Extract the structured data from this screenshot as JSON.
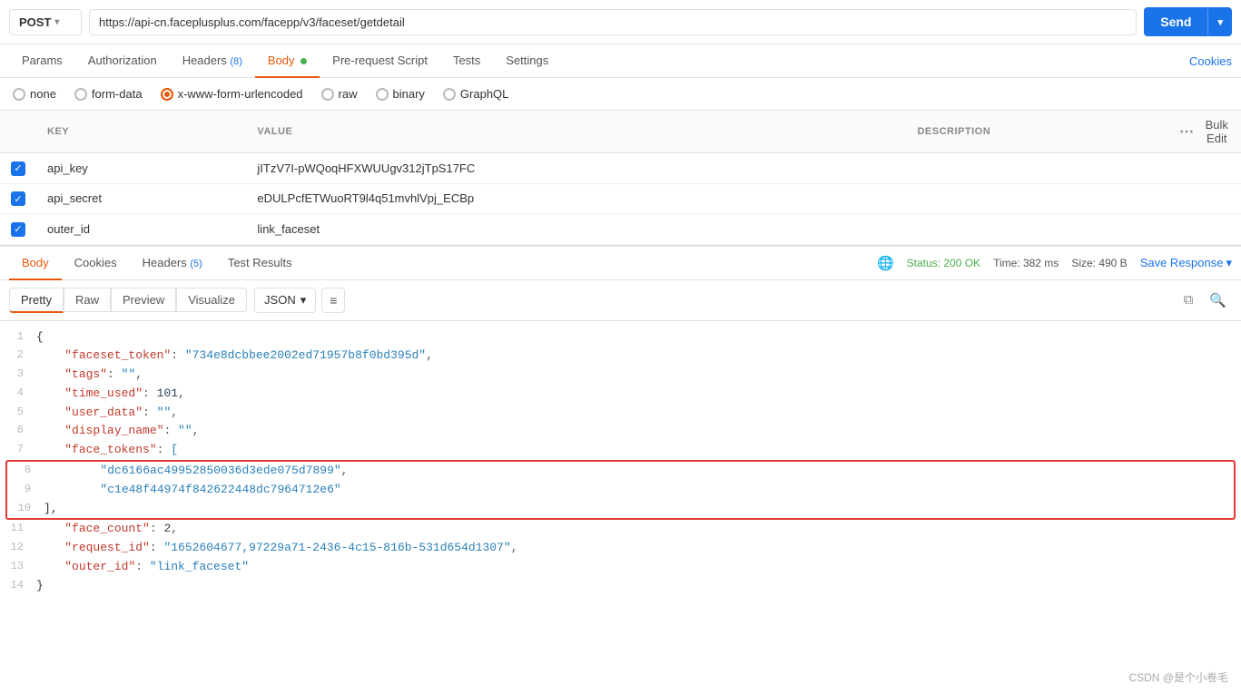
{
  "url_bar": {
    "method": "POST",
    "url": "https://api-cn.faceplusplus.com/facepp/v3/faceset/getdetail",
    "send_label": "Send"
  },
  "req_tabs": [
    {
      "label": "Params",
      "active": false,
      "badge": ""
    },
    {
      "label": "Authorization",
      "active": false,
      "badge": ""
    },
    {
      "label": "Headers",
      "active": false,
      "badge": "(8)"
    },
    {
      "label": "Body",
      "active": true,
      "badge": "",
      "dot": true
    },
    {
      "label": "Pre-request Script",
      "active": false,
      "badge": ""
    },
    {
      "label": "Tests",
      "active": false,
      "badge": ""
    },
    {
      "label": "Settings",
      "active": false,
      "badge": ""
    }
  ],
  "cookies_label": "Cookies",
  "body_types": [
    {
      "label": "none",
      "active": false
    },
    {
      "label": "form-data",
      "active": false
    },
    {
      "label": "x-www-form-urlencoded",
      "active": true
    },
    {
      "label": "raw",
      "active": false
    },
    {
      "label": "binary",
      "active": false
    },
    {
      "label": "GraphQL",
      "active": false
    }
  ],
  "table": {
    "headers": [
      "",
      "KEY",
      "VALUE",
      "DESCRIPTION",
      "",
      "Bulk Edit"
    ],
    "rows": [
      {
        "checked": true,
        "key": "api_key",
        "value": "jITzV7I-pWQoqHFXWUUgv312jTpS17FC",
        "desc": ""
      },
      {
        "checked": true,
        "key": "api_secret",
        "value": "eDULPcfETWuoRT9l4q51mvhlVpj_ECBp",
        "desc": ""
      },
      {
        "checked": true,
        "key": "outer_id",
        "value": "link_faceset",
        "desc": ""
      }
    ]
  },
  "resp_tabs": [
    {
      "label": "Body",
      "active": true,
      "badge": ""
    },
    {
      "label": "Cookies",
      "active": false,
      "badge": ""
    },
    {
      "label": "Headers",
      "active": false,
      "badge": "(5)"
    },
    {
      "label": "Test Results",
      "active": false,
      "badge": ""
    }
  ],
  "resp_status": {
    "status": "Status: 200 OK",
    "time": "Time: 382 ms",
    "size": "Size: 490 B"
  },
  "save_response_label": "Save Response",
  "resp_toolbar": {
    "views": [
      "Pretty",
      "Raw",
      "Preview",
      "Visualize"
    ],
    "active_view": "Pretty",
    "format": "JSON",
    "wrap_icon": "≡"
  },
  "json_lines": [
    {
      "num": 1,
      "content": "{"
    },
    {
      "num": 2,
      "key": "faceset_token",
      "value": "\"734e8dcbbee2002ed71957b8f0bd395d\"",
      "colon": ": ",
      "comma": ","
    },
    {
      "num": 3,
      "key": "tags",
      "value": "\"\"",
      "colon": ": ",
      "comma": ","
    },
    {
      "num": 4,
      "key": "time_used",
      "value": "101",
      "colon": ": ",
      "comma": ",",
      "num_val": true
    },
    {
      "num": 5,
      "key": "user_data",
      "value": "\"\"",
      "colon": ": ",
      "comma": ","
    },
    {
      "num": 6,
      "key": "display_name",
      "value": "\"\"",
      "colon": ": ",
      "comma": ","
    },
    {
      "num": 7,
      "key": "face_tokens",
      "value": "[",
      "colon": ": ",
      "comma": "",
      "highlight_start": true
    },
    {
      "num": 8,
      "indent": true,
      "value": "\"dc6166ac49952850036d3ede075d7899\"",
      "comma": ",",
      "highlight": true
    },
    {
      "num": 9,
      "indent": true,
      "value": "\"c1e48f44974f842622448dc7964712e6\"",
      "comma": "",
      "highlight": true
    },
    {
      "num": 10,
      "content": "],",
      "highlight_end": true
    },
    {
      "num": 11,
      "key": "face_count",
      "value": "2",
      "colon": ": ",
      "comma": ",",
      "num_val": true
    },
    {
      "num": 12,
      "key": "request_id",
      "value": "\"1652604677,97229a71-2436-4c15-816b-531d654d1307\"",
      "colon": ": ",
      "comma": ","
    },
    {
      "num": 13,
      "key": "outer_id",
      "value": "\"link_faceset\"",
      "colon": ": ",
      "comma": ""
    },
    {
      "num": 14,
      "content": "}"
    }
  ],
  "watermark": "CSDN @是个小卷毛"
}
